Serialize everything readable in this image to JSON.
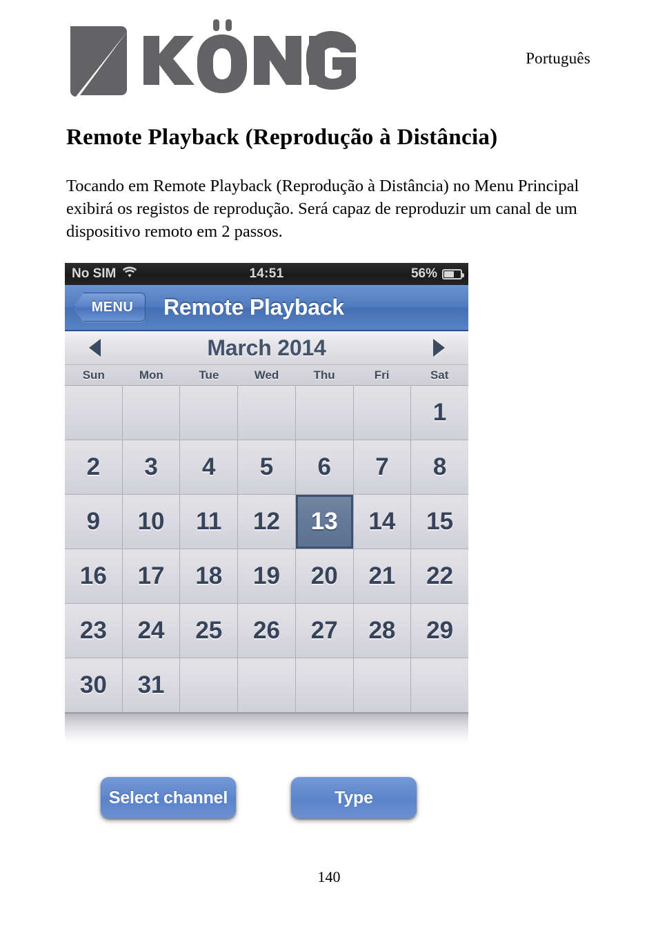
{
  "header": {
    "language": "Português",
    "logo_name": "könig-logo",
    "logo_wordmark": "KÖNIG"
  },
  "article": {
    "title": "Remote Playback (Reprodução à Distância)",
    "paragraph": "Tocando em Remote Playback (Reprodução à Distância) no Menu Principal exibirá os registos de reprodução. Será capaz de reproduzir um canal de um dispositivo remoto em 2 passos."
  },
  "phone": {
    "status_bar": {
      "carrier": "No SIM",
      "wifi_icon": "wifi-icon",
      "time": "14:51",
      "battery_percent": "56%",
      "battery_icon": "battery-icon",
      "battery_level": 56
    },
    "nav_bar": {
      "back_button": "MENU",
      "title": "Remote Playback"
    },
    "calendar": {
      "prev_icon": "triangle-left-icon",
      "next_icon": "triangle-right-icon",
      "month_label": "March 2014",
      "weekdays": [
        "Sun",
        "Mon",
        "Tue",
        "Wed",
        "Thu",
        "Fri",
        "Sat"
      ],
      "leading_blanks": 6,
      "days": [
        1,
        2,
        3,
        4,
        5,
        6,
        7,
        8,
        9,
        10,
        11,
        12,
        13,
        14,
        15,
        16,
        17,
        18,
        19,
        20,
        21,
        22,
        23,
        24,
        25,
        26,
        27,
        28,
        29,
        30,
        31
      ],
      "selected_day": 13,
      "trailing_blanks": 5
    }
  },
  "actions": {
    "select_channel_label": "Select channel",
    "type_label": "Type"
  },
  "footer": {
    "page_number": "140"
  },
  "colors": {
    "nav_blue": "#4f7cc0",
    "button_blue": "#6088cd",
    "selected_day": "#64799a",
    "selected_day_border": "#3e5172",
    "logo_gray": "#636366",
    "status_bar_bg": "#1a1a1a"
  }
}
